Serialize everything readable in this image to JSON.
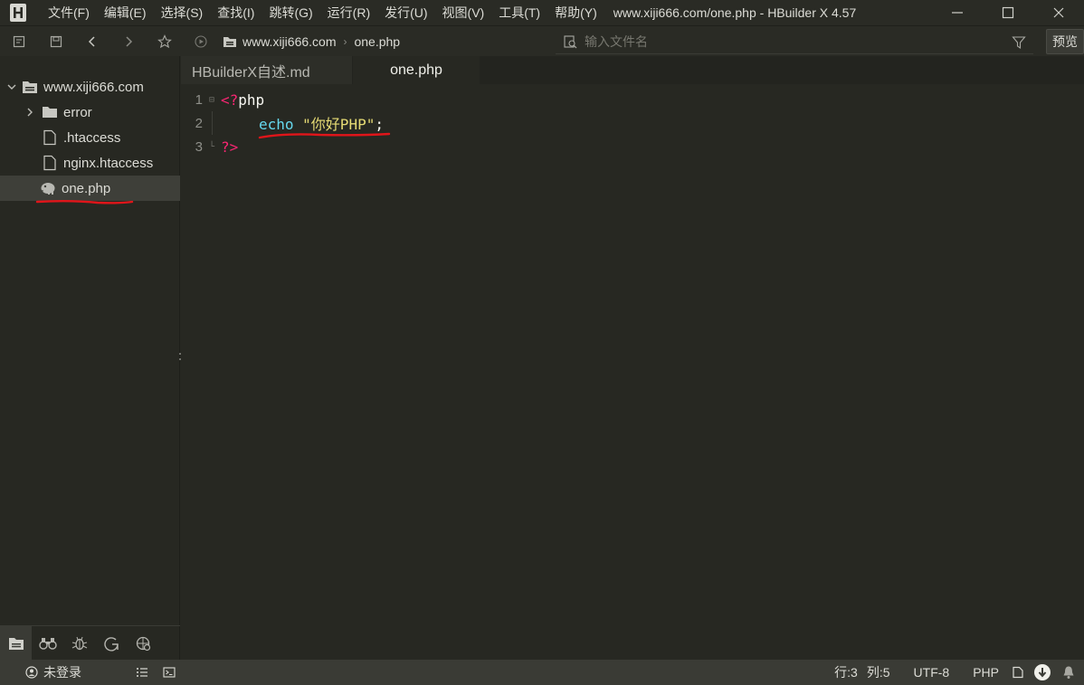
{
  "window": {
    "title": "www.xiji666.com/one.php - HBuilder X 4.57"
  },
  "menu": [
    {
      "label": "文件(F)"
    },
    {
      "label": "编辑(E)"
    },
    {
      "label": "选择(S)"
    },
    {
      "label": "查找(I)"
    },
    {
      "label": "跳转(G)"
    },
    {
      "label": "运行(R)"
    },
    {
      "label": "发行(U)"
    },
    {
      "label": "视图(V)"
    },
    {
      "label": "工具(T)"
    },
    {
      "label": "帮助(Y)"
    }
  ],
  "toolbar": {
    "breadcrumb": [
      "www.xiji666.com",
      "one.php"
    ],
    "search_placeholder": "输入文件名",
    "preview_label": "预览"
  },
  "sidebar": {
    "project": "www.xiji666.com",
    "items": [
      {
        "label": "error",
        "type": "folder"
      },
      {
        "label": ".htaccess",
        "type": "file"
      },
      {
        "label": "nginx.htaccess",
        "type": "file"
      },
      {
        "label": "one.php",
        "type": "php",
        "selected": true
      }
    ]
  },
  "tabs": [
    {
      "label": "HBuilderX自述.md",
      "active": false
    },
    {
      "label": "one.php",
      "active": true
    }
  ],
  "editor": {
    "lines": [
      {
        "num": "1",
        "open_tag": "<?",
        "rest": "php"
      },
      {
        "num": "2",
        "keyword": "echo",
        "string": "\"你好PHP\"",
        "punct": ";"
      },
      {
        "num": "3",
        "close_tag": "?>"
      }
    ]
  },
  "status": {
    "login": "未登录",
    "row": "行:3",
    "col": "列:5",
    "encoding": "UTF-8",
    "language": "PHP"
  },
  "colors": {
    "annotation_red": "#e0151a",
    "tag": "#f92672",
    "keyword": "#66d9ef",
    "string": "#e6db74"
  }
}
